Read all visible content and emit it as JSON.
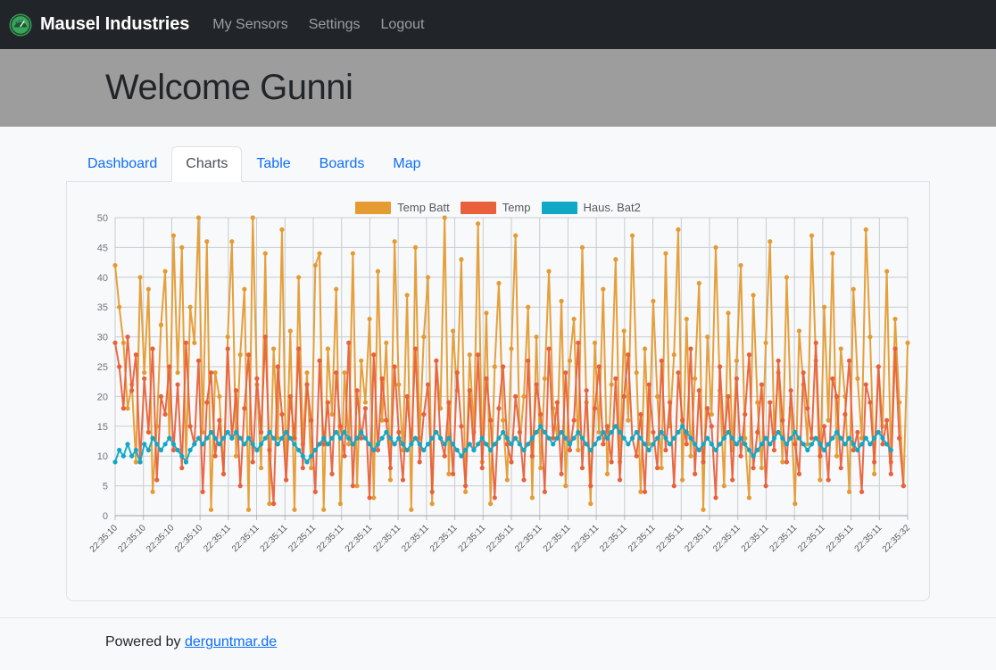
{
  "navbar": {
    "brand": "Mausel Industries",
    "brand_icon": "gauge-icon",
    "links": [
      {
        "label": "My Sensors"
      },
      {
        "label": "Settings"
      },
      {
        "label": "Logout"
      }
    ]
  },
  "header": {
    "title": "Welcome Gunni"
  },
  "tabs": [
    {
      "label": "Dashboard",
      "active": false
    },
    {
      "label": "Charts",
      "active": true
    },
    {
      "label": "Table",
      "active": false
    },
    {
      "label": "Boards",
      "active": false
    },
    {
      "label": "Map",
      "active": false
    }
  ],
  "footer": {
    "prefix": "Powered by ",
    "link_text": "derguntmar.de"
  },
  "colors": {
    "accent_link": "#0d6efd",
    "navbar_bg": "#212529",
    "jumbotron_bg": "#9d9d9d",
    "series_temp_batt": "#e49b31",
    "series_temp": "#e8613c",
    "series_haus_bat2": "#11a8c5",
    "grid": "#c8ccd0",
    "plot_bg": "#f8f9fa"
  },
  "chart_data": {
    "type": "line",
    "title": "",
    "xlabel": "",
    "ylabel": "",
    "ylim": [
      0,
      50
    ],
    "yticks": [
      0,
      5,
      10,
      15,
      20,
      25,
      30,
      35,
      40,
      45,
      50
    ],
    "grid": true,
    "legend_position": "top-center",
    "marker": "circle",
    "x_tick_rotation": -45,
    "x_tick_labels": [
      "22:35:10",
      "22:35:10",
      "22:35:10",
      "22:35:10",
      "22:35:11",
      "22:35:11",
      "22:35:11",
      "22:35:11",
      "22:35:11",
      "22:35:11",
      "22:35:11",
      "22:35:11",
      "22:35:11",
      "22:35:11",
      "22:35:11",
      "22:35:11",
      "22:35:11",
      "22:35:11",
      "22:35:11",
      "22:35:11",
      "22:35:11",
      "22:35:11",
      "22:35:11",
      "22:35:11",
      "22:35:11",
      "22:35:11",
      "22:35:11",
      "22:35:11",
      "22:35:32"
    ],
    "series": [
      {
        "name": "Temp Batt",
        "color": "#e49b31",
        "values": [
          42,
          35,
          29,
          18,
          22,
          9,
          40,
          24,
          38,
          4,
          15,
          32,
          41,
          13,
          47,
          24,
          45,
          9,
          35,
          29,
          50,
          14,
          46,
          1,
          24,
          20,
          7,
          30,
          46,
          10,
          27,
          38,
          1,
          50,
          22,
          8,
          44,
          2,
          28,
          13,
          48,
          6,
          31,
          1,
          40,
          12,
          24,
          8,
          42,
          44,
          1,
          28,
          17,
          38,
          2,
          24,
          12,
          44,
          5,
          26,
          19,
          33,
          3,
          41,
          16,
          29,
          6,
          46,
          22,
          11,
          37,
          1,
          45,
          13,
          30,
          40,
          2,
          26,
          18,
          50,
          7,
          31,
          21,
          43,
          4,
          27,
          14,
          49,
          9,
          34,
          2,
          25,
          39,
          16,
          6,
          28,
          47,
          12,
          20,
          35,
          3,
          30,
          8,
          23,
          41,
          18,
          13,
          36,
          5,
          26,
          33,
          11,
          45,
          19,
          2,
          29,
          14,
          38,
          7,
          22,
          43,
          9,
          31,
          16,
          47,
          24,
          4,
          28,
          12,
          36,
          20,
          8,
          44,
          15,
          27,
          48,
          6,
          33,
          10,
          23,
          39,
          1,
          30,
          17,
          45,
          21,
          5,
          34,
          11,
          26,
          42,
          13,
          3,
          37,
          19,
          8,
          29,
          46,
          14,
          24,
          9,
          40,
          18,
          2,
          31,
          22,
          12,
          47,
          26,
          6,
          35,
          16,
          44,
          10,
          28,
          20,
          4,
          38,
          23,
          13,
          48,
          30,
          7,
          25,
          15,
          41,
          9,
          33,
          19,
          5,
          29
        ]
      },
      {
        "name": "Temp",
        "color": "#e8613c",
        "values": [
          29,
          25,
          18,
          30,
          21,
          27,
          9,
          23,
          14,
          28,
          6,
          20,
          17,
          25,
          11,
          22,
          8,
          29,
          15,
          12,
          26,
          4,
          19,
          24,
          10,
          16,
          7,
          28,
          13,
          21,
          5,
          18,
          27,
          9,
          23,
          14,
          30,
          11,
          2,
          25,
          17,
          6,
          20,
          13,
          28,
          8,
          22,
          16,
          4,
          26,
          12,
          19,
          7,
          24,
          15,
          10,
          29,
          5,
          21,
          13,
          18,
          3,
          27,
          11,
          23,
          16,
          8,
          25,
          14,
          6,
          20,
          12,
          28,
          9,
          17,
          22,
          4,
          26,
          13,
          10,
          19,
          7,
          24,
          15,
          5,
          21,
          11,
          27,
          8,
          23,
          16,
          3,
          18,
          25,
          12,
          9,
          20,
          14,
          6,
          26,
          10,
          22,
          17,
          4,
          28,
          13,
          19,
          7,
          24,
          11,
          16,
          29,
          8,
          21,
          5,
          18,
          25,
          12,
          15,
          9,
          23,
          6,
          20,
          27,
          13,
          10,
          17,
          4,
          22,
          14,
          8,
          26,
          11,
          19,
          5,
          24,
          16,
          12,
          28,
          7,
          21,
          9,
          18,
          15,
          3,
          25,
          13,
          20,
          6,
          23,
          10,
          17,
          27,
          8,
          14,
          22,
          5,
          19,
          11,
          26,
          16,
          9,
          21,
          12,
          7,
          24,
          18,
          13,
          29,
          10,
          15,
          6,
          23,
          20,
          8,
          17,
          26,
          11,
          14,
          4,
          22,
          19,
          9,
          25,
          12,
          16,
          7,
          28,
          13,
          5
        ]
      },
      {
        "name": "Haus. Bat2",
        "color": "#11a8c5",
        "values": [
          9,
          11,
          10,
          12,
          10,
          11,
          9,
          12,
          11,
          13,
          12,
          11,
          12,
          13,
          12,
          11,
          10,
          9,
          11,
          12,
          13,
          12,
          13,
          14,
          13,
          12,
          13,
          14,
          13,
          14,
          13,
          12,
          13,
          12,
          11,
          12,
          13,
          14,
          13,
          12,
          13,
          14,
          13,
          12,
          11,
          10,
          9,
          10,
          11,
          12,
          13,
          12,
          13,
          14,
          13,
          14,
          13,
          12,
          13,
          14,
          13,
          12,
          11,
          12,
          13,
          14,
          13,
          12,
          13,
          12,
          11,
          12,
          13,
          12,
          11,
          12,
          13,
          14,
          13,
          12,
          13,
          12,
          11,
          10,
          11,
          12,
          11,
          12,
          13,
          12,
          11,
          12,
          13,
          14,
          13,
          12,
          13,
          12,
          11,
          12,
          13,
          14,
          15,
          14,
          13,
          12,
          13,
          14,
          13,
          12,
          13,
          14,
          13,
          12,
          11,
          12,
          13,
          14,
          13,
          14,
          15,
          14,
          13,
          12,
          13,
          14,
          13,
          12,
          11,
          12,
          13,
          14,
          13,
          12,
          13,
          14,
          15,
          14,
          13,
          12,
          11,
          12,
          13,
          12,
          11,
          12,
          13,
          14,
          13,
          12,
          13,
          12,
          11,
          10,
          11,
          12,
          13,
          12,
          13,
          14,
          13,
          12,
          13,
          14,
          13,
          12,
          11,
          12,
          13,
          12,
          11,
          12,
          13,
          14,
          13,
          12,
          13,
          12,
          11,
          12,
          13,
          12,
          13,
          14,
          13,
          12,
          11
        ]
      }
    ]
  }
}
